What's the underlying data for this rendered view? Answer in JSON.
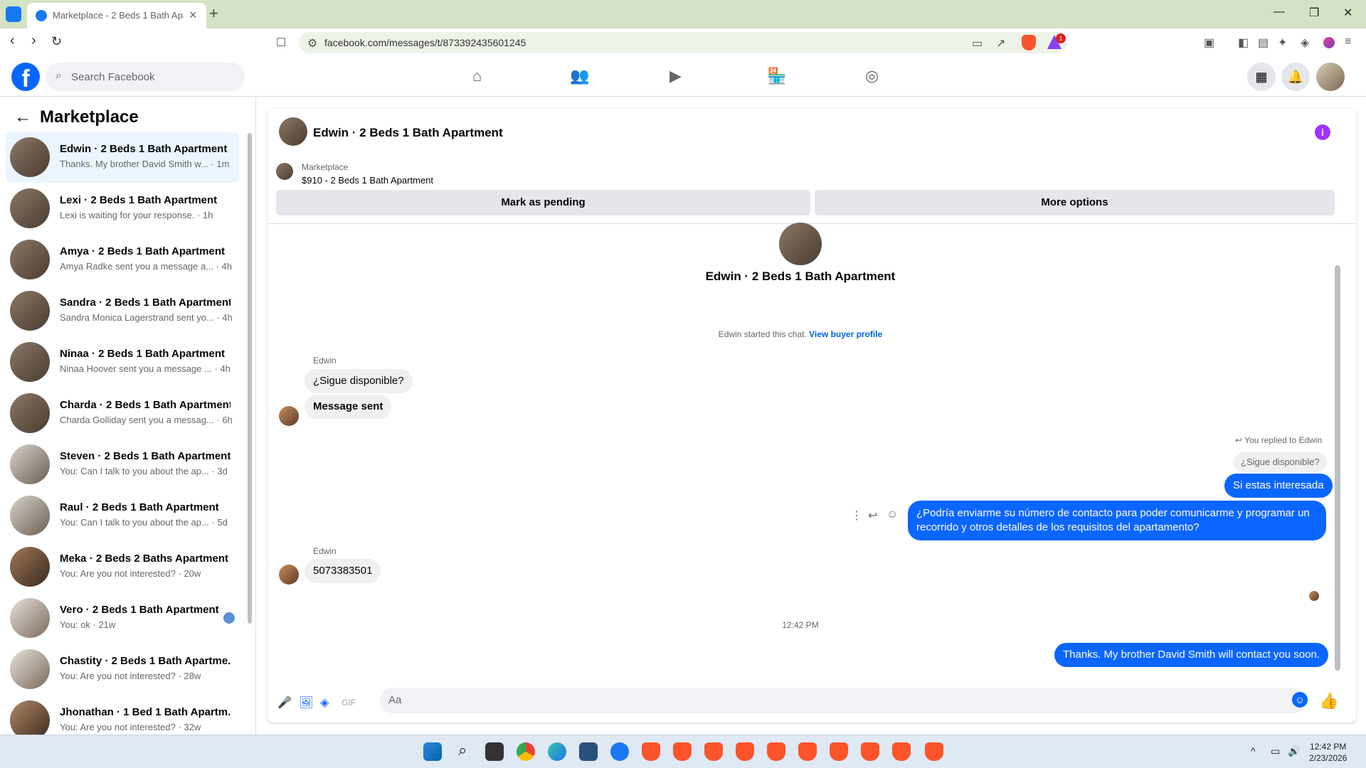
{
  "browser": {
    "tab_title": "Marketplace - 2 Beds 1 Bath Apartme...",
    "url": "facebook.com/messages/t/873392435601245",
    "brave_badge": "1"
  },
  "fb": {
    "logo": "f",
    "search_placeholder": "Search Facebook"
  },
  "sidebar": {
    "title": "Marketplace",
    "conversations": [
      {
        "name": "Edwin · 2 Beds 1 Bath Apartment",
        "preview": "Thanks. My brother David Smith w... · 1m"
      },
      {
        "name": "Lexi · 2 Beds 1 Bath Apartment",
        "preview": "Lexi is waiting for your response. · 1h"
      },
      {
        "name": "Amya · 2 Beds 1 Bath Apartment",
        "preview": "Amya Radke sent you a message a... · 4h"
      },
      {
        "name": "Sandra · 2 Beds 1 Bath Apartment",
        "preview": "Sandra Monica Lagerstrand sent yo... · 4h"
      },
      {
        "name": "Ninaa · 2 Beds 1 Bath Apartment",
        "preview": "Ninaa Hoover sent you a message ... · 4h"
      },
      {
        "name": "Charda · 2 Beds 1 Bath Apartment",
        "preview": "Charda Golliday sent you a messag... · 6h"
      },
      {
        "name": "Steven · 2 Beds 1 Bath Apartment",
        "preview": "You: Can I talk to you about the ap... · 3d"
      },
      {
        "name": "Raul · 2 Beds 1 Bath Apartment",
        "preview": "You: Can I talk to you about the ap... · 5d"
      },
      {
        "name": "Meka · 2 Beds 2 Baths Apartment",
        "preview": "You: Are you not interested? · 20w"
      },
      {
        "name": "Vero · 2 Beds 1 Bath Apartment",
        "preview": "You: ok · 21w"
      },
      {
        "name": "Chastity · 2 Beds 1 Bath Apartme...",
        "preview": "You: Are you not interested? · 28w"
      },
      {
        "name": "Jhonathan · 1 Bed 1 Bath Apartm...",
        "preview": "You: Are you not interested? · 32w"
      }
    ]
  },
  "chat": {
    "header_title": "Edwin · 2 Beds 1 Bath Apartment",
    "listing_category": "Marketplace",
    "listing_title": "$910 - 2 Beds 1 Bath Apartment",
    "mark_pending_label": "Mark as pending",
    "more_options_label": "More options",
    "hero_name": "Edwin · 2 Beds 1 Bath Apartment",
    "started_text": "Edwin started this chat.",
    "view_profile_link": "View buyer profile",
    "sender_1": "Edwin",
    "msg_in_1": "¿Sigue disponible?",
    "msg_in_2": "Message sent",
    "reply_label": "You replied to Edwin",
    "reply_quote": "¿Sigue disponible?",
    "msg_out_1": "Si estas interesada",
    "msg_out_2": "¿Podría enviarme su número de contacto para poder comunicarme y programar un recorrido y otros detalles de los requisitos del apartamento?",
    "sender_2": "Edwin",
    "msg_in_3": "5073383501",
    "timestamp": "12:42 PM",
    "msg_out_3": "Thanks. My brother David Smith will contact you soon.",
    "compose_placeholder": "Aa"
  },
  "taskbar": {
    "time": "12:42 PM",
    "date": "2/23/2026"
  },
  "colors": {
    "accent": "#0a66ff",
    "fb_blue": "#0866ff",
    "tab_bar": "#d3e3c4",
    "info_purple": "#a033ff",
    "brave_orange": "#fb542b"
  }
}
